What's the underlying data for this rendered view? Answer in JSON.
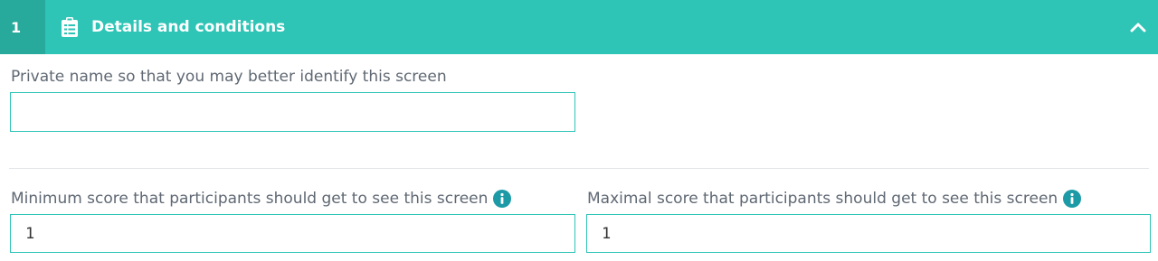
{
  "header": {
    "step_number": "1",
    "title": "Details and conditions",
    "color": "#2ec4b6",
    "icon": "clipboard-list-icon",
    "toggle_icon": "chevron-up-icon"
  },
  "private_name": {
    "label": "Private name so that you may better identify this screen",
    "value": ""
  },
  "min_score": {
    "label": "Minimum score that participants should get to see this screen",
    "value": "1",
    "icon": "info-icon"
  },
  "max_score": {
    "label": "Maximal score that participants should get to see this screen",
    "value": "1",
    "icon": "info-icon"
  }
}
